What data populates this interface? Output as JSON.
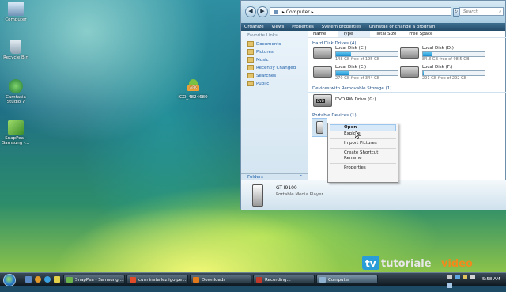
{
  "desktop": {
    "icons": [
      {
        "label": "Computer",
        "color": "#9ab6d4"
      },
      {
        "label": "Recycle Bin",
        "color": "#8fa3b4"
      },
      {
        "label": "Camtasia Studio 7",
        "color": "#3c9a4a"
      },
      {
        "label": "SnapPea - Samsung -...",
        "color": "#6bb44b"
      },
      {
        "label": "iGO_4824680",
        "badge": "APK",
        "color": "#7bc142"
      }
    ]
  },
  "explorer": {
    "breadcrumb": [
      "Computer"
    ],
    "search_placeholder": "Search",
    "toolbar": [
      "Organize",
      "Views",
      "Properties",
      "System properties",
      "Uninstall or change a program"
    ],
    "columns": [
      "Name",
      "Type",
      "Total Size",
      "Free Space"
    ],
    "favorites_header": "Favorite Links",
    "favorites": [
      "Documents",
      "Pictures",
      "Music",
      "Recently Changed",
      "Searches",
      "Public"
    ],
    "folders_label": "Folders",
    "groups": {
      "hdd": "Hard Disk Drives (4)",
      "removable": "Devices with Removable Storage (1)",
      "portable": "Portable Devices (1)"
    },
    "drives": [
      {
        "name": "Local Disk (C:)",
        "free": "148 GB free of 195 GB",
        "used_fraction": 0.24
      },
      {
        "name": "Local Disk (D:)",
        "free": "84.8 GB free of 98.5 GB",
        "used_fraction": 0.14
      },
      {
        "name": "Local Disk (E:)",
        "free": "270 GB free of 344 GB",
        "used_fraction": 0.22
      },
      {
        "name": "Local Disk (F:)",
        "free": "291 GB free of 292 GB",
        "used_fraction": 0.01
      }
    ],
    "dvd": {
      "name": "DVD RW Drive (G:)",
      "badge": "DVD"
    },
    "details": {
      "name": "GT-I9100",
      "type": "Portable Media Player"
    }
  },
  "context_menu": [
    "Open",
    "Explore",
    "Import Pictures",
    "Create Shortcut",
    "Rename",
    "Properties"
  ],
  "taskbar": {
    "buttons": [
      {
        "label": "SnapPea - Samsung ...",
        "color": "#6bb44b"
      },
      {
        "label": "cum installez igo pe ...",
        "color": "#e04b2a"
      },
      {
        "label": "Downloads",
        "color": "#e07a1d"
      },
      {
        "label": "Recording...",
        "color": "#c0392b"
      },
      {
        "label": "Computer",
        "color": "#8fb1d0"
      }
    ],
    "clock": "5:58 AM"
  },
  "brand": {
    "prefix": "tv",
    "word1": "tutoriale",
    "word2": "video"
  }
}
